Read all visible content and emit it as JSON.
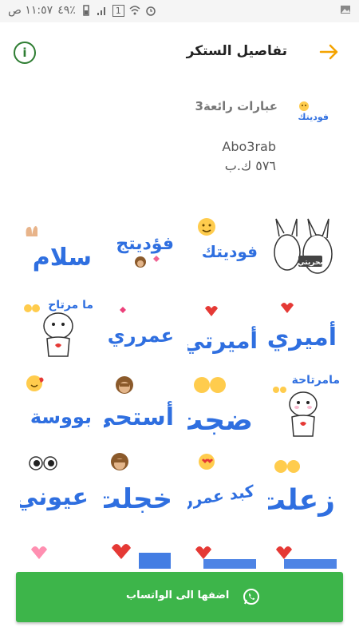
{
  "status_bar": {
    "time": "١١:٥٧ ص",
    "battery": "٤٩٪",
    "notification_badge": "1"
  },
  "header": {
    "title": "تفاصيل الستكر"
  },
  "pack": {
    "name": "عبارات رائعة3",
    "tray_label": "فوديتك",
    "author": "Abo3rab",
    "size": "٥٧٦ ك.ب"
  },
  "stickers": [
    {
      "text": "سلام"
    },
    {
      "text": "فؤديتج"
    },
    {
      "text": "فوديتك"
    },
    {
      "text": "بحريتي"
    },
    {
      "text": "ما مرتاح"
    },
    {
      "text": "عمرري"
    },
    {
      "text": "أميرتي"
    },
    {
      "text": "أميري"
    },
    {
      "text": "بووسة"
    },
    {
      "text": "أستحي"
    },
    {
      "text": "ضجت"
    },
    {
      "text": "مامرتاحة"
    },
    {
      "text": "عيوني"
    },
    {
      "text": "خجلت"
    },
    {
      "text": "كبد عمرري"
    },
    {
      "text": "زعلت"
    }
  ],
  "cta": {
    "label": "اضفها الى الواتساب"
  },
  "colors": {
    "accent_green": "#3db54a",
    "info_green": "#2e7d32",
    "arrow_orange": "#f4a300",
    "sticker_blue": "#2f6fe0"
  }
}
